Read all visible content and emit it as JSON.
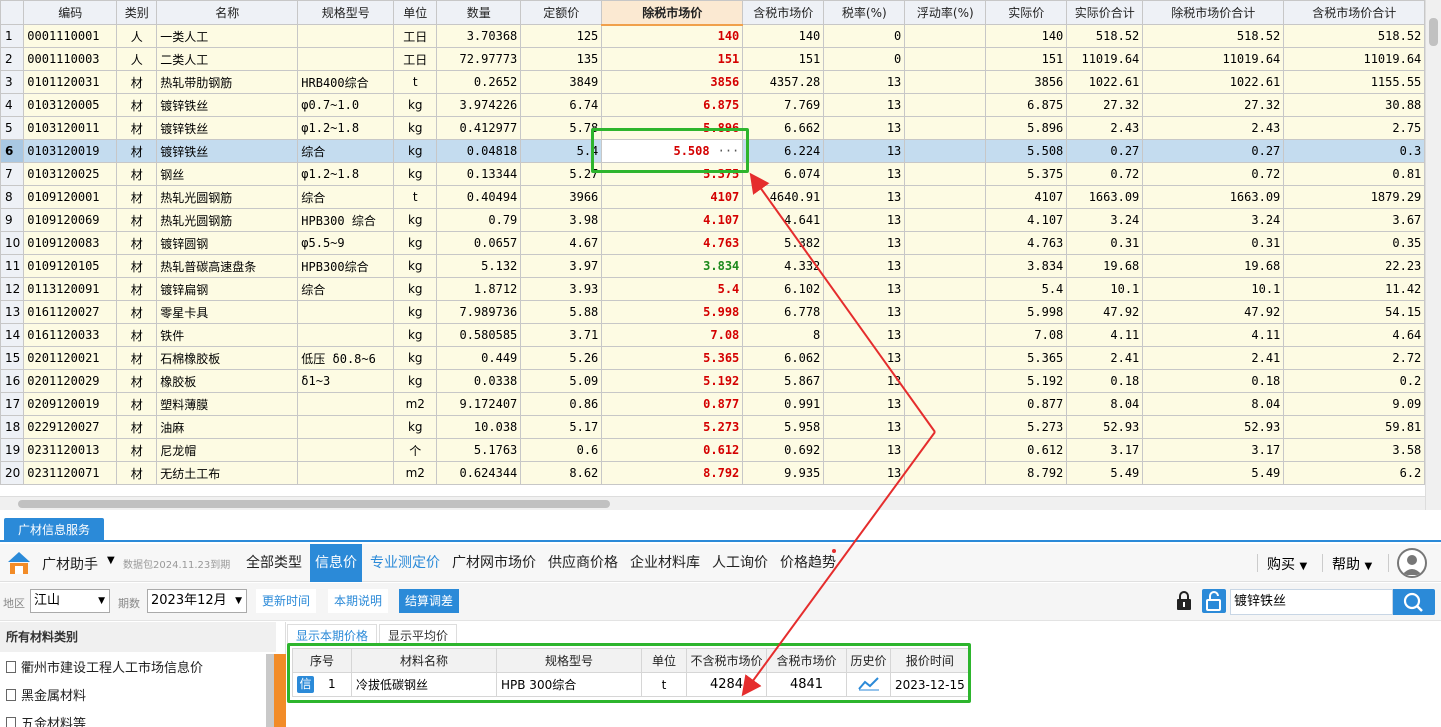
{
  "grid": {
    "columns": [
      "",
      "编码",
      "类别",
      "名称",
      "规格型号",
      "单位",
      "数量",
      "定额价",
      "除税市场价",
      "含税市场价",
      "税率(%)",
      "浮动率(%)",
      "实际价",
      "实际价合计",
      "除税市场价合计",
      "含税市场价合计"
    ],
    "rows": [
      {
        "n": "1",
        "code": "0001110001",
        "cat": "人",
        "name": "一类人工",
        "spec": "",
        "unit": "工日",
        "qty": "3.70368",
        "quota": "125",
        "mkt": "140",
        "mktc": "red",
        "mkt_tax": "140",
        "rate": "0",
        "float": "",
        "actual": "140",
        "actual_sum": "518.52",
        "mkt_sum": "518.52",
        "mkt_tax_sum": "518.52"
      },
      {
        "n": "2",
        "code": "0001110003",
        "cat": "人",
        "name": "二类人工",
        "spec": "",
        "unit": "工日",
        "qty": "72.97773",
        "quota": "135",
        "mkt": "151",
        "mktc": "red",
        "mkt_tax": "151",
        "rate": "0",
        "float": "",
        "actual": "151",
        "actual_sum": "11019.64",
        "mkt_sum": "11019.64",
        "mkt_tax_sum": "11019.64"
      },
      {
        "n": "3",
        "code": "0101120031",
        "cat": "材",
        "name": "热轧带肋钢筋",
        "spec": "HRB400综合",
        "unit": "t",
        "qty": "0.2652",
        "quota": "3849",
        "mkt": "3856",
        "mktc": "red",
        "mkt_tax": "4357.28",
        "rate": "13",
        "float": "",
        "actual": "3856",
        "actual_sum": "1022.61",
        "mkt_sum": "1022.61",
        "mkt_tax_sum": "1155.55"
      },
      {
        "n": "4",
        "code": "0103120005",
        "cat": "材",
        "name": "镀锌铁丝",
        "spec": "φ0.7~1.0",
        "unit": "kg",
        "qty": "3.974226",
        "quota": "6.74",
        "mkt": "6.875",
        "mktc": "red",
        "mkt_tax": "7.769",
        "rate": "13",
        "float": "",
        "actual": "6.875",
        "actual_sum": "27.32",
        "mkt_sum": "27.32",
        "mkt_tax_sum": "30.88"
      },
      {
        "n": "5",
        "code": "0103120011",
        "cat": "材",
        "name": "镀锌铁丝",
        "spec": "φ1.2~1.8",
        "unit": "kg",
        "qty": "0.412977",
        "quota": "5.78",
        "mkt": "5.896",
        "mktc": "red",
        "mkt_tax": "6.662",
        "rate": "13",
        "float": "",
        "actual": "5.896",
        "actual_sum": "2.43",
        "mkt_sum": "2.43",
        "mkt_tax_sum": "2.75"
      },
      {
        "n": "6",
        "code": "0103120019",
        "cat": "材",
        "name": "镀锌铁丝",
        "spec": "综合",
        "unit": "kg",
        "qty": "0.04818",
        "quota": "5.4",
        "mkt": "5.508",
        "mktc": "red",
        "mkt_tax": "6.224",
        "rate": "13",
        "float": "",
        "actual": "5.508",
        "actual_sum": "0.27",
        "mkt_sum": "0.27",
        "mkt_tax_sum": "0.3"
      },
      {
        "n": "7",
        "code": "0103120025",
        "cat": "材",
        "name": "钢丝",
        "spec": "φ1.2~1.8",
        "unit": "kg",
        "qty": "0.13344",
        "quota": "5.27",
        "mkt": "5.375",
        "mktc": "red",
        "mkt_tax": "6.074",
        "rate": "13",
        "float": "",
        "actual": "5.375",
        "actual_sum": "0.72",
        "mkt_sum": "0.72",
        "mkt_tax_sum": "0.81"
      },
      {
        "n": "8",
        "code": "0109120001",
        "cat": "材",
        "name": "热轧光圆钢筋",
        "spec": "综合",
        "unit": "t",
        "qty": "0.40494",
        "quota": "3966",
        "mkt": "4107",
        "mktc": "red",
        "mkt_tax": "4640.91",
        "rate": "13",
        "float": "",
        "actual": "4107",
        "actual_sum": "1663.09",
        "mkt_sum": "1663.09",
        "mkt_tax_sum": "1879.29"
      },
      {
        "n": "9",
        "code": "0109120069",
        "cat": "材",
        "name": "热轧光圆钢筋",
        "spec": "HPB300 综合",
        "unit": "kg",
        "qty": "0.79",
        "quota": "3.98",
        "mkt": "4.107",
        "mktc": "red",
        "mkt_tax": "4.641",
        "rate": "13",
        "float": "",
        "actual": "4.107",
        "actual_sum": "3.24",
        "mkt_sum": "3.24",
        "mkt_tax_sum": "3.67"
      },
      {
        "n": "10",
        "code": "0109120083",
        "cat": "材",
        "name": "镀锌圆钢",
        "spec": "φ5.5~9",
        "unit": "kg",
        "qty": "0.0657",
        "quota": "4.67",
        "mkt": "4.763",
        "mktc": "red",
        "mkt_tax": "5.382",
        "rate": "13",
        "float": "",
        "actual": "4.763",
        "actual_sum": "0.31",
        "mkt_sum": "0.31",
        "mkt_tax_sum": "0.35"
      },
      {
        "n": "11",
        "code": "0109120105",
        "cat": "材",
        "name": "热轧普碳高速盘条",
        "spec": "HPB300综合",
        "unit": "kg",
        "qty": "5.132",
        "quota": "3.97",
        "mkt": "3.834",
        "mktc": "green",
        "mkt_tax": "4.332",
        "rate": "13",
        "float": "",
        "actual": "3.834",
        "actual_sum": "19.68",
        "mkt_sum": "19.68",
        "mkt_tax_sum": "22.23"
      },
      {
        "n": "12",
        "code": "0113120091",
        "cat": "材",
        "name": "镀锌扁钢",
        "spec": "综合",
        "unit": "kg",
        "qty": "1.8712",
        "quota": "3.93",
        "mkt": "5.4",
        "mktc": "red",
        "mkt_tax": "6.102",
        "rate": "13",
        "float": "",
        "actual": "5.4",
        "actual_sum": "10.1",
        "mkt_sum": "10.1",
        "mkt_tax_sum": "11.42"
      },
      {
        "n": "13",
        "code": "0161120027",
        "cat": "材",
        "name": "零星卡具",
        "spec": "",
        "unit": "kg",
        "qty": "7.989736",
        "quota": "5.88",
        "mkt": "5.998",
        "mktc": "red",
        "mkt_tax": "6.778",
        "rate": "13",
        "float": "",
        "actual": "5.998",
        "actual_sum": "47.92",
        "mkt_sum": "47.92",
        "mkt_tax_sum": "54.15"
      },
      {
        "n": "14",
        "code": "0161120033",
        "cat": "材",
        "name": "铁件",
        "spec": "",
        "unit": "kg",
        "qty": "0.580585",
        "quota": "3.71",
        "mkt": "7.08",
        "mktc": "red",
        "mkt_tax": "8",
        "rate": "13",
        "float": "",
        "actual": "7.08",
        "actual_sum": "4.11",
        "mkt_sum": "4.11",
        "mkt_tax_sum": "4.64"
      },
      {
        "n": "15",
        "code": "0201120021",
        "cat": "材",
        "name": "石棉橡胶板",
        "spec": "低压 δ0.8~6",
        "unit": "kg",
        "qty": "0.449",
        "quota": "5.26",
        "mkt": "5.365",
        "mktc": "red",
        "mkt_tax": "6.062",
        "rate": "13",
        "float": "",
        "actual": "5.365",
        "actual_sum": "2.41",
        "mkt_sum": "2.41",
        "mkt_tax_sum": "2.72"
      },
      {
        "n": "16",
        "code": "0201120029",
        "cat": "材",
        "name": "橡胶板",
        "spec": "δ1~3",
        "unit": "kg",
        "qty": "0.0338",
        "quota": "5.09",
        "mkt": "5.192",
        "mktc": "red",
        "mkt_tax": "5.867",
        "rate": "13",
        "float": "",
        "actual": "5.192",
        "actual_sum": "0.18",
        "mkt_sum": "0.18",
        "mkt_tax_sum": "0.2"
      },
      {
        "n": "17",
        "code": "0209120019",
        "cat": "材",
        "name": "塑料薄膜",
        "spec": "",
        "unit": "m2",
        "qty": "9.172407",
        "quota": "0.86",
        "mkt": "0.877",
        "mktc": "red",
        "mkt_tax": "0.991",
        "rate": "13",
        "float": "",
        "actual": "0.877",
        "actual_sum": "8.04",
        "mkt_sum": "8.04",
        "mkt_tax_sum": "9.09"
      },
      {
        "n": "18",
        "code": "0229120027",
        "cat": "材",
        "name": "油麻",
        "spec": "",
        "unit": "kg",
        "qty": "10.038",
        "quota": "5.17",
        "mkt": "5.273",
        "mktc": "red",
        "mkt_tax": "5.958",
        "rate": "13",
        "float": "",
        "actual": "5.273",
        "actual_sum": "52.93",
        "mkt_sum": "52.93",
        "mkt_tax_sum": "59.81"
      },
      {
        "n": "19",
        "code": "0231120013",
        "cat": "材",
        "name": "尼龙帽",
        "spec": "",
        "unit": "个",
        "qty": "5.1763",
        "quota": "0.6",
        "mkt": "0.612",
        "mktc": "red",
        "mkt_tax": "0.692",
        "rate": "13",
        "float": "",
        "actual": "0.612",
        "actual_sum": "3.17",
        "mkt_sum": "3.17",
        "mkt_tax_sum": "3.58"
      },
      {
        "n": "20",
        "code": "0231120071",
        "cat": "材",
        "name": "无纺土工布",
        "spec": "",
        "unit": "m2",
        "qty": "0.624344",
        "quota": "8.62",
        "mkt": "8.792",
        "mktc": "red",
        "mkt_tax": "9.935",
        "rate": "13",
        "float": "",
        "actual": "8.792",
        "actual_sum": "5.49",
        "mkt_sum": "5.49",
        "mkt_tax_sum": "6.2"
      }
    ],
    "selected_row": 6,
    "edit_ellipsis": "···"
  },
  "panel": {
    "tab_label": "广材信息服务",
    "assistant_label": "广材助手",
    "package_date": "数据包2024.11.23到期",
    "nav": [
      "全部类型",
      "信息价",
      "专业测定价",
      "广材网市场价",
      "供应商价格",
      "企业材料库",
      "人工询价",
      "价格趋势"
    ],
    "buy_label": "购买",
    "help_label": "帮助",
    "region_label": "地区",
    "region_value": "江山",
    "period_label": "期数",
    "period_value": "2023年12月",
    "btn_update_time": "更新时间",
    "btn_period_note": "本期说明",
    "btn_settle": "结算调差",
    "search_value": "镀锌铁丝",
    "category_title": "所有材料类别",
    "categories": [
      "衢州市建设工程人工市场信息价",
      "黑金属材料",
      "五金材料等"
    ],
    "sub_tabs": [
      "显示本期价格",
      "显示平均价"
    ],
    "result_columns": [
      "序号",
      "材料名称",
      "规格型号",
      "单位",
      "不含税市场价",
      "含税市场价",
      "历史价",
      "报价时间"
    ],
    "result_rows": [
      {
        "badge": "信",
        "seq": "1",
        "name": "冷拔低碳钢丝",
        "spec": "HPB 300综合",
        "unit": "t",
        "price": "4284",
        "price_tax": "4841",
        "date": "2023-12-15"
      }
    ]
  },
  "colors": {
    "accent": "#2b8ad8",
    "price_up": "#d40000",
    "price_down": "#1d8a1d",
    "annotation_box": "#2db52d",
    "annotation_arrow": "#e52d2d"
  }
}
